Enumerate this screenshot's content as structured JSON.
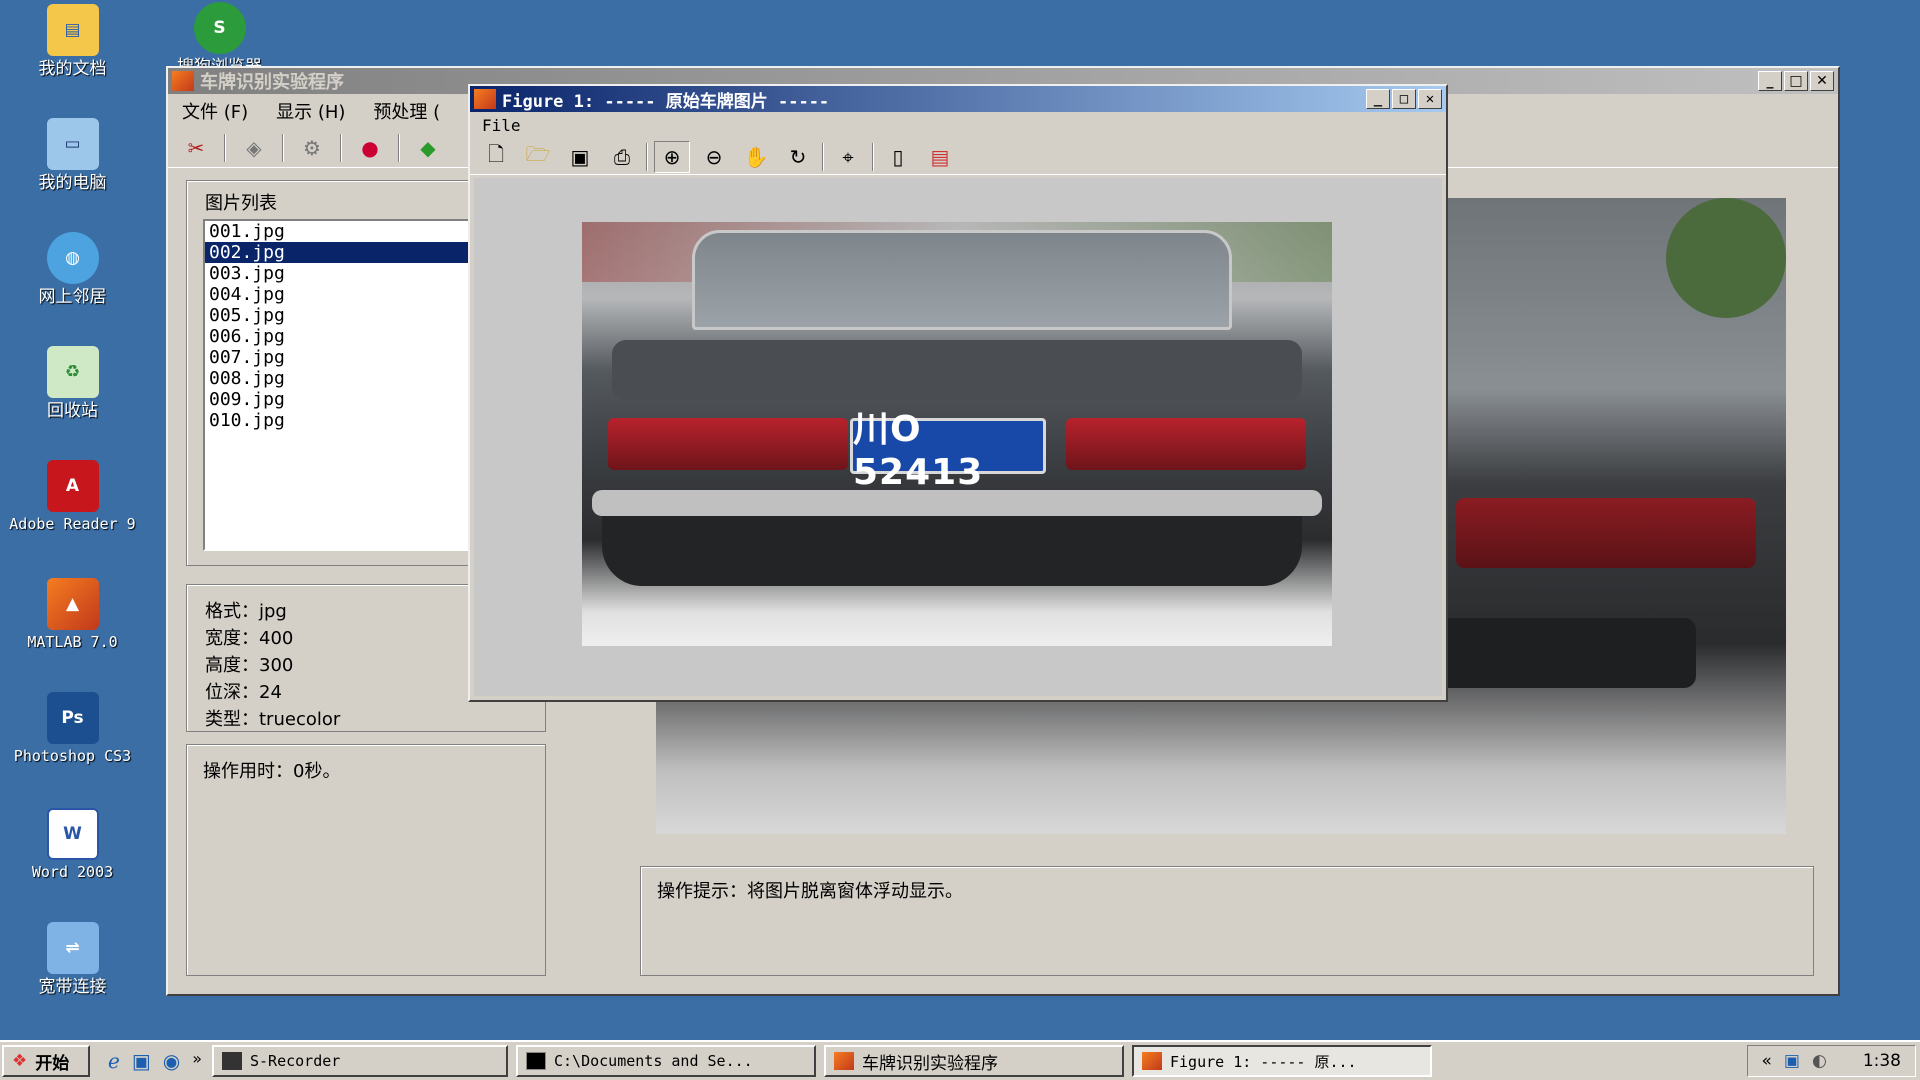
{
  "desktop": {
    "icons": [
      {
        "label": "我的文档",
        "icon": "my-documents-icon"
      },
      {
        "label": "搜狗浏览器",
        "icon": "sogou-browser-icon"
      },
      {
        "label": "我的电脑",
        "icon": "my-computer-icon"
      },
      {
        "label": "网上邻居",
        "icon": "network-places-icon"
      },
      {
        "label": "回收站",
        "icon": "recycle-bin-icon"
      },
      {
        "label": "Adobe Reader 9",
        "icon": "adobe-reader-icon"
      },
      {
        "label": "MATLAB 7.0",
        "icon": "matlab-icon"
      },
      {
        "label": "Photoshop CS3",
        "icon": "photoshop-icon"
      },
      {
        "label": "Word 2003",
        "icon": "word-icon"
      },
      {
        "label": "宽带连接",
        "icon": "broadband-icon"
      }
    ]
  },
  "main_window": {
    "title": "车牌识别实验程序",
    "menu": [
      "文件 (F)",
      "显示 (H)",
      "预处理 ("
    ],
    "list_title": "图片列表",
    "files": [
      "001.jpg",
      "002.jpg",
      "003.jpg",
      "004.jpg",
      "005.jpg",
      "006.jpg",
      "007.jpg",
      "008.jpg",
      "009.jpg",
      "010.jpg"
    ],
    "selected_index": 1,
    "info": {
      "format": "格式：jpg",
      "width": "宽度：400",
      "height": "高度：300",
      "depth": "位深：24",
      "type": "类型：truecolor"
    },
    "elapsed": "操作用时：0秒。",
    "hint": "操作提示：将图片脱离窗体浮动显示。"
  },
  "figure_window": {
    "title": "Figure 1: ----- 原始车牌图片 -----",
    "menu": "File",
    "plate_text": "川O 52413"
  },
  "taskbar": {
    "start": "开始",
    "tasks": [
      "S-Recorder",
      "C:\\Documents and Se...",
      "车牌识别实验程序",
      "Figure 1: ----- 原..."
    ],
    "clock": "1:38"
  },
  "colors": {
    "desktop": "#3a6ea5",
    "title_active": "#0a246a",
    "selection": "#0a246a"
  }
}
